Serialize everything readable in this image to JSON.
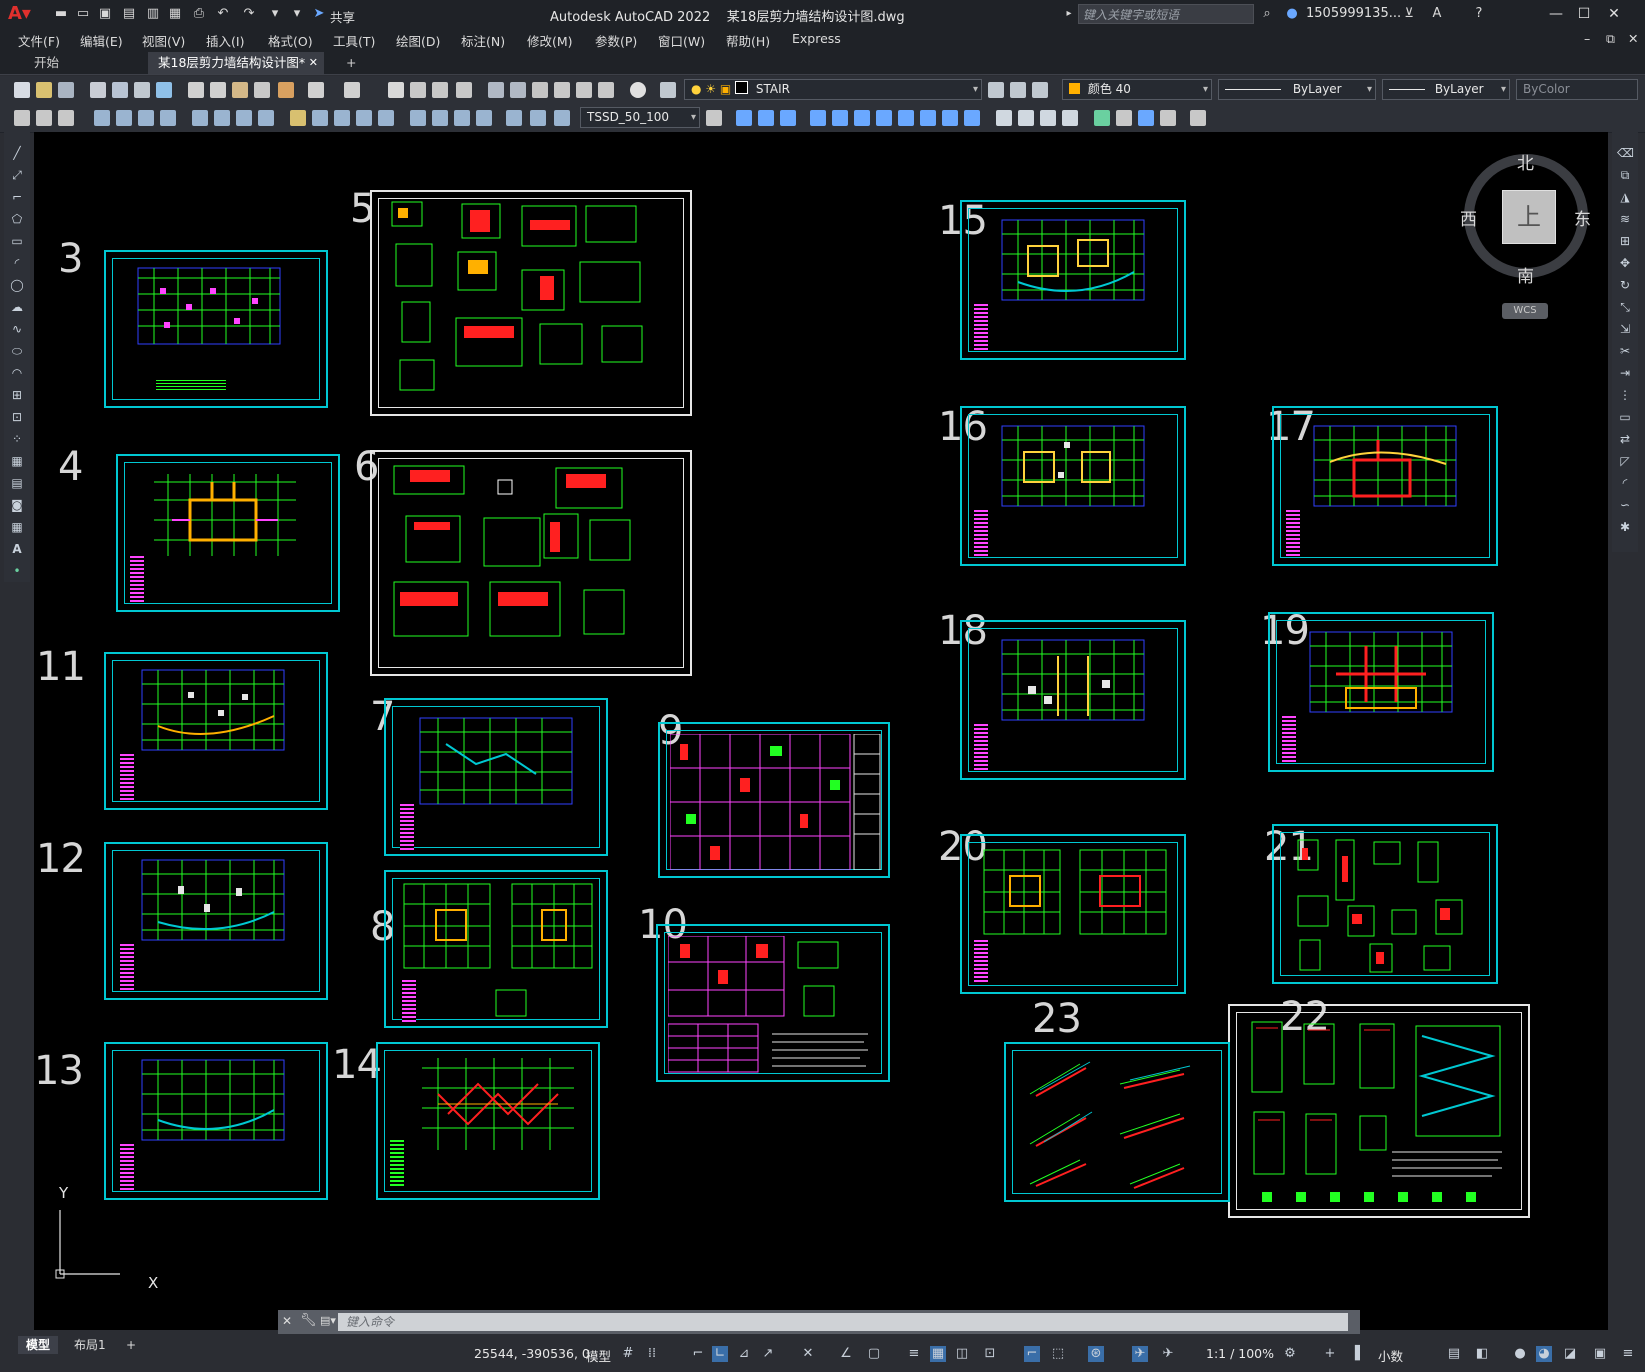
{
  "titlebar": {
    "app_name": "Autodesk AutoCAD 2022",
    "file_name": "某18层剪力墙结构设计图.dwg",
    "share_label": "共享",
    "search_placeholder": "键入关键字或短语",
    "user": "1505999135..."
  },
  "menu": [
    "文件(F)",
    "编辑(E)",
    "视图(V)",
    "插入(I)",
    "格式(O)",
    "工具(T)",
    "绘图(D)",
    "标注(N)",
    "修改(M)",
    "参数(P)",
    "窗口(W)",
    "帮助(H)",
    "Express"
  ],
  "tabs": {
    "start": "开始",
    "document": "某18层剪力墙结构设计图*",
    "add": "+"
  },
  "toolbar": {
    "layer": "STAIR",
    "color": "颜色 40",
    "linetype": "ByLayer",
    "lineweight": "ByLayer",
    "plotstyle": "ByColor",
    "textstyle": "TSSD_50_100",
    "color_swatch": "#ffb000"
  },
  "compass": {
    "north": "北",
    "south": "南",
    "east": "东",
    "west": "西",
    "top": "上",
    "wcs": "WCS"
  },
  "ucs": {
    "x": "X",
    "y": "Y"
  },
  "sheets": [
    "3",
    "4",
    "5",
    "6",
    "7",
    "8",
    "9",
    "10",
    "11",
    "12",
    "13",
    "14",
    "15",
    "16",
    "17",
    "18",
    "19",
    "20",
    "21",
    "22",
    "23"
  ],
  "command": {
    "placeholder": "键入命令"
  },
  "statusbar": {
    "tab_model": "模型",
    "tab_layout": "布局1",
    "add": "+",
    "coords": "25544, -390536, 0",
    "space": "模型",
    "scale": "1:1 / 100%",
    "units": "小数"
  },
  "colors": {
    "frame": "#00c8d2",
    "canvas": "#000000",
    "grid_green": "#22ff22",
    "grid_blue": "#3040ff",
    "accent_magenta": "#ff44ff",
    "accent_red": "#ff2020"
  }
}
